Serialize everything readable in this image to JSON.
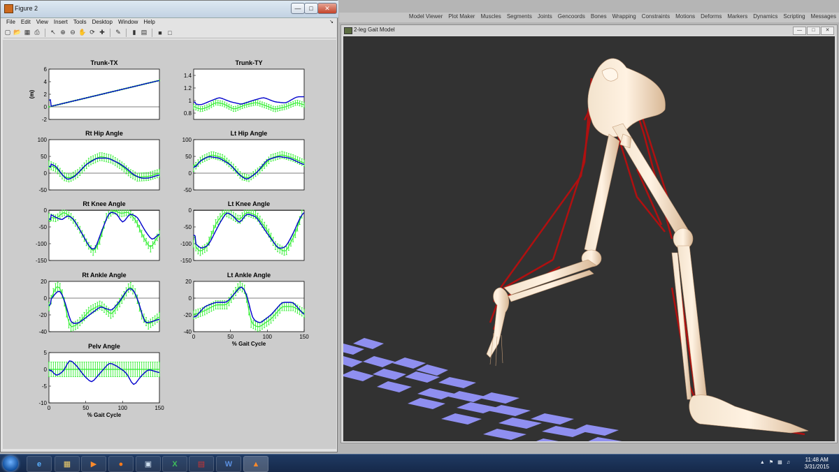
{
  "figure_window": {
    "title": "Figure 2",
    "menu": [
      "File",
      "Edit",
      "View",
      "Insert",
      "Tools",
      "Desktop",
      "Window",
      "Help"
    ]
  },
  "app_menu": [
    "Model Viewer",
    "Plot Maker",
    "Muscles",
    "Segments",
    "Joints",
    "Gencoords",
    "Bones",
    "Wrapping",
    "Constraints",
    "Motions",
    "Deforms",
    "Markers",
    "Dynamics",
    "Scripting",
    "Messages"
  ],
  "model_viewer": {
    "title": "2-leg Gait Model"
  },
  "taskbar": {
    "time": "11:48 AM",
    "date": "3/31/2015"
  },
  "colors": {
    "sim": "#0000cc",
    "exp": "#33ee33",
    "bg_plot": "#ffffff"
  },
  "chart_data": [
    {
      "type": "line",
      "title": "Trunk-TX",
      "ylabel": "(m)",
      "xlabel": "",
      "ylim": [
        -2,
        6
      ],
      "yticks": [
        -2,
        0,
        2,
        4,
        6
      ],
      "xlim": [
        0,
        150
      ],
      "xticks": [],
      "sim": [
        [
          0,
          0
        ],
        [
          150,
          4.2
        ]
      ],
      "exp": [
        [
          0,
          0
        ],
        [
          150,
          4.2
        ]
      ],
      "err": 0.08
    },
    {
      "type": "line",
      "title": "Trunk-TY",
      "ylabel": "",
      "xlabel": "",
      "ylim": [
        0.7,
        1.5
      ],
      "yticks": [
        0.8,
        1,
        1.2,
        1.4
      ],
      "xlim": [
        0,
        150
      ],
      "xticks": [],
      "sim": [
        [
          0,
          0.95
        ],
        [
          10,
          0.93
        ],
        [
          20,
          0.98
        ],
        [
          35,
          1.05
        ],
        [
          50,
          0.98
        ],
        [
          65,
          0.94
        ],
        [
          80,
          1.0
        ],
        [
          95,
          1.05
        ],
        [
          110,
          0.98
        ],
        [
          125,
          0.96
        ],
        [
          140,
          1.06
        ],
        [
          150,
          1.06
        ]
      ],
      "exp": [
        [
          0,
          0.9
        ],
        [
          10,
          0.86
        ],
        [
          20,
          0.9
        ],
        [
          30,
          0.97
        ],
        [
          40,
          0.95
        ],
        [
          55,
          0.86
        ],
        [
          70,
          0.93
        ],
        [
          85,
          0.97
        ],
        [
          100,
          0.91
        ],
        [
          110,
          0.86
        ],
        [
          125,
          0.9
        ],
        [
          140,
          0.97
        ],
        [
          150,
          0.93
        ]
      ],
      "err": 0.04
    },
    {
      "type": "line",
      "title": "Rt Hip Angle",
      "ylabel": "",
      "xlabel": "",
      "ylim": [
        -50,
        100
      ],
      "yticks": [
        -50,
        0,
        50,
        100
      ],
      "xlim": [
        0,
        150
      ],
      "xticks": [],
      "sim": [
        [
          0,
          30
        ],
        [
          10,
          20
        ],
        [
          18,
          -5
        ],
        [
          25,
          -20
        ],
        [
          35,
          -10
        ],
        [
          50,
          25
        ],
        [
          65,
          45
        ],
        [
          80,
          45
        ],
        [
          95,
          30
        ],
        [
          105,
          15
        ],
        [
          115,
          -5
        ],
        [
          125,
          -15
        ],
        [
          135,
          -15
        ],
        [
          150,
          -5
        ]
      ],
      "exp": [
        [
          0,
          25
        ],
        [
          10,
          15
        ],
        [
          20,
          -10
        ],
        [
          28,
          -15
        ],
        [
          40,
          0
        ],
        [
          55,
          35
        ],
        [
          70,
          50
        ],
        [
          85,
          42
        ],
        [
          100,
          20
        ],
        [
          110,
          0
        ],
        [
          120,
          -12
        ],
        [
          135,
          -10
        ],
        [
          150,
          0
        ]
      ],
      "err": 12
    },
    {
      "type": "line",
      "title": "Lt Hip Angle",
      "ylabel": "",
      "xlabel": "",
      "ylim": [
        -50,
        100
      ],
      "yticks": [
        -50,
        0,
        50,
        100
      ],
      "xlim": [
        0,
        150
      ],
      "xticks": [],
      "sim": [
        [
          0,
          10
        ],
        [
          8,
          35
        ],
        [
          20,
          50
        ],
        [
          35,
          45
        ],
        [
          50,
          25
        ],
        [
          62,
          -5
        ],
        [
          72,
          -20
        ],
        [
          85,
          0
        ],
        [
          100,
          40
        ],
        [
          115,
          50
        ],
        [
          130,
          45
        ],
        [
          150,
          25
        ]
      ],
      "exp": [
        [
          0,
          15
        ],
        [
          10,
          40
        ],
        [
          25,
          55
        ],
        [
          40,
          45
        ],
        [
          55,
          15
        ],
        [
          65,
          -10
        ],
        [
          75,
          -15
        ],
        [
          90,
          10
        ],
        [
          105,
          45
        ],
        [
          120,
          55
        ],
        [
          135,
          45
        ],
        [
          150,
          30
        ]
      ],
      "err": 10
    },
    {
      "type": "line",
      "title": "Rt Knee Angle",
      "ylabel": "",
      "xlabel": "",
      "ylim": [
        -150,
        0
      ],
      "yticks": [
        -150,
        -100,
        -50,
        0
      ],
      "xlim": [
        0,
        150
      ],
      "xticks": [],
      "sim": [
        [
          0,
          -10
        ],
        [
          8,
          -20
        ],
        [
          18,
          -30
        ],
        [
          25,
          -15
        ],
        [
          33,
          -25
        ],
        [
          45,
          -70
        ],
        [
          55,
          -110
        ],
        [
          62,
          -120
        ],
        [
          72,
          -60
        ],
        [
          82,
          -5
        ],
        [
          92,
          -10
        ],
        [
          100,
          -40
        ],
        [
          110,
          -10
        ],
        [
          120,
          -20
        ],
        [
          130,
          -60
        ],
        [
          140,
          -90
        ],
        [
          150,
          -70
        ]
      ],
      "exp": [
        [
          0,
          -20
        ],
        [
          10,
          -25
        ],
        [
          20,
          -5
        ],
        [
          30,
          -20
        ],
        [
          40,
          -50
        ],
        [
          52,
          -100
        ],
        [
          60,
          -125
        ],
        [
          68,
          -100
        ],
        [
          78,
          -20
        ],
        [
          88,
          0
        ],
        [
          98,
          -10
        ],
        [
          108,
          -5
        ],
        [
          118,
          -30
        ],
        [
          128,
          -80
        ],
        [
          138,
          -115
        ],
        [
          150,
          -70
        ]
      ],
      "err": 10
    },
    {
      "type": "line",
      "title": "Lt Knee Angle",
      "ylabel": "",
      "xlabel": "",
      "ylim": [
        -150,
        0
      ],
      "yticks": [
        -150,
        -100,
        -50,
        0
      ],
      "xlim": [
        0,
        150
      ],
      "xticks": [],
      "sim": [
        [
          0,
          -95
        ],
        [
          10,
          -115
        ],
        [
          20,
          -105
        ],
        [
          35,
          -40
        ],
        [
          45,
          -5
        ],
        [
          55,
          -20
        ],
        [
          62,
          -40
        ],
        [
          72,
          -10
        ],
        [
          85,
          -20
        ],
        [
          100,
          -70
        ],
        [
          115,
          -115
        ],
        [
          125,
          -110
        ],
        [
          135,
          -70
        ],
        [
          145,
          -20
        ],
        [
          150,
          -5
        ]
      ],
      "exp": [
        [
          0,
          -100
        ],
        [
          8,
          -125
        ],
        [
          18,
          -110
        ],
        [
          30,
          -40
        ],
        [
          42,
          -5
        ],
        [
          52,
          -15
        ],
        [
          62,
          -30
        ],
        [
          72,
          -5
        ],
        [
          85,
          -15
        ],
        [
          100,
          -60
        ],
        [
          112,
          -110
        ],
        [
          125,
          -125
        ],
        [
          138,
          -70
        ],
        [
          148,
          -5
        ]
      ],
      "err": 12
    },
    {
      "type": "line",
      "title": "Rt Ankle Angle",
      "ylabel": "",
      "xlabel": "",
      "ylim": [
        -40,
        20
      ],
      "yticks": [
        -40,
        -20,
        0,
        20
      ],
      "xlim": [
        0,
        150
      ],
      "xticks": [],
      "sim": [
        [
          0,
          -5
        ],
        [
          8,
          5
        ],
        [
          15,
          10
        ],
        [
          22,
          -5
        ],
        [
          30,
          -30
        ],
        [
          40,
          -30
        ],
        [
          55,
          -20
        ],
        [
          70,
          -10
        ],
        [
          85,
          -15
        ],
        [
          95,
          -5
        ],
        [
          108,
          12
        ],
        [
          115,
          10
        ],
        [
          122,
          -5
        ],
        [
          130,
          -30
        ],
        [
          140,
          -28
        ],
        [
          150,
          -25
        ]
      ],
      "exp": [
        [
          0,
          -10
        ],
        [
          8,
          12
        ],
        [
          14,
          15
        ],
        [
          20,
          0
        ],
        [
          28,
          -35
        ],
        [
          38,
          -32
        ],
        [
          55,
          -15
        ],
        [
          70,
          -8
        ],
        [
          85,
          -20
        ],
        [
          100,
          0
        ],
        [
          110,
          15
        ],
        [
          118,
          5
        ],
        [
          126,
          -20
        ],
        [
          135,
          -32
        ],
        [
          150,
          -22
        ]
      ],
      "err": 5
    },
    {
      "type": "line",
      "title": "Lt Ankle Angle",
      "ylabel": "",
      "xlabel": "% Gait Cycle",
      "ylim": [
        -40,
        20
      ],
      "yticks": [
        -40,
        -20,
        0,
        20
      ],
      "xlim": [
        0,
        150
      ],
      "xticks": [
        0,
        50,
        100,
        150
      ],
      "sim": [
        [
          0,
          -25
        ],
        [
          15,
          -10
        ],
        [
          30,
          -5
        ],
        [
          45,
          -5
        ],
        [
          55,
          5
        ],
        [
          65,
          15
        ],
        [
          72,
          5
        ],
        [
          80,
          -25
        ],
        [
          90,
          -30
        ],
        [
          105,
          -20
        ],
        [
          120,
          -5
        ],
        [
          135,
          -5
        ],
        [
          150,
          -20
        ]
      ],
      "exp": [
        [
          0,
          -20
        ],
        [
          15,
          -15
        ],
        [
          30,
          -8
        ],
        [
          45,
          -8
        ],
        [
          55,
          5
        ],
        [
          62,
          15
        ],
        [
          70,
          10
        ],
        [
          78,
          -30
        ],
        [
          88,
          -35
        ],
        [
          105,
          -25
        ],
        [
          120,
          -10
        ],
        [
          135,
          -10
        ],
        [
          150,
          -18
        ]
      ],
      "err": 5
    },
    {
      "type": "line",
      "title": "Pelv Angle",
      "ylabel": "",
      "xlabel": "% Gait Cycle",
      "ylim": [
        -10,
        5
      ],
      "yticks": [
        -10,
        -5,
        0,
        5
      ],
      "xlim": [
        0,
        150
      ],
      "xticks": [
        0,
        50,
        100,
        150
      ],
      "sim": [
        [
          0,
          0.5
        ],
        [
          10,
          -2
        ],
        [
          20,
          -0.5
        ],
        [
          28,
          3
        ],
        [
          38,
          1
        ],
        [
          48,
          -2
        ],
        [
          58,
          -4
        ],
        [
          70,
          -1
        ],
        [
          82,
          2
        ],
        [
          92,
          1
        ],
        [
          105,
          -1
        ],
        [
          115,
          -5
        ],
        [
          125,
          -2
        ],
        [
          135,
          0
        ],
        [
          150,
          -1
        ]
      ],
      "exp": [
        [
          0,
          0
        ],
        [
          150,
          0
        ]
      ],
      "err": 2.2
    }
  ]
}
